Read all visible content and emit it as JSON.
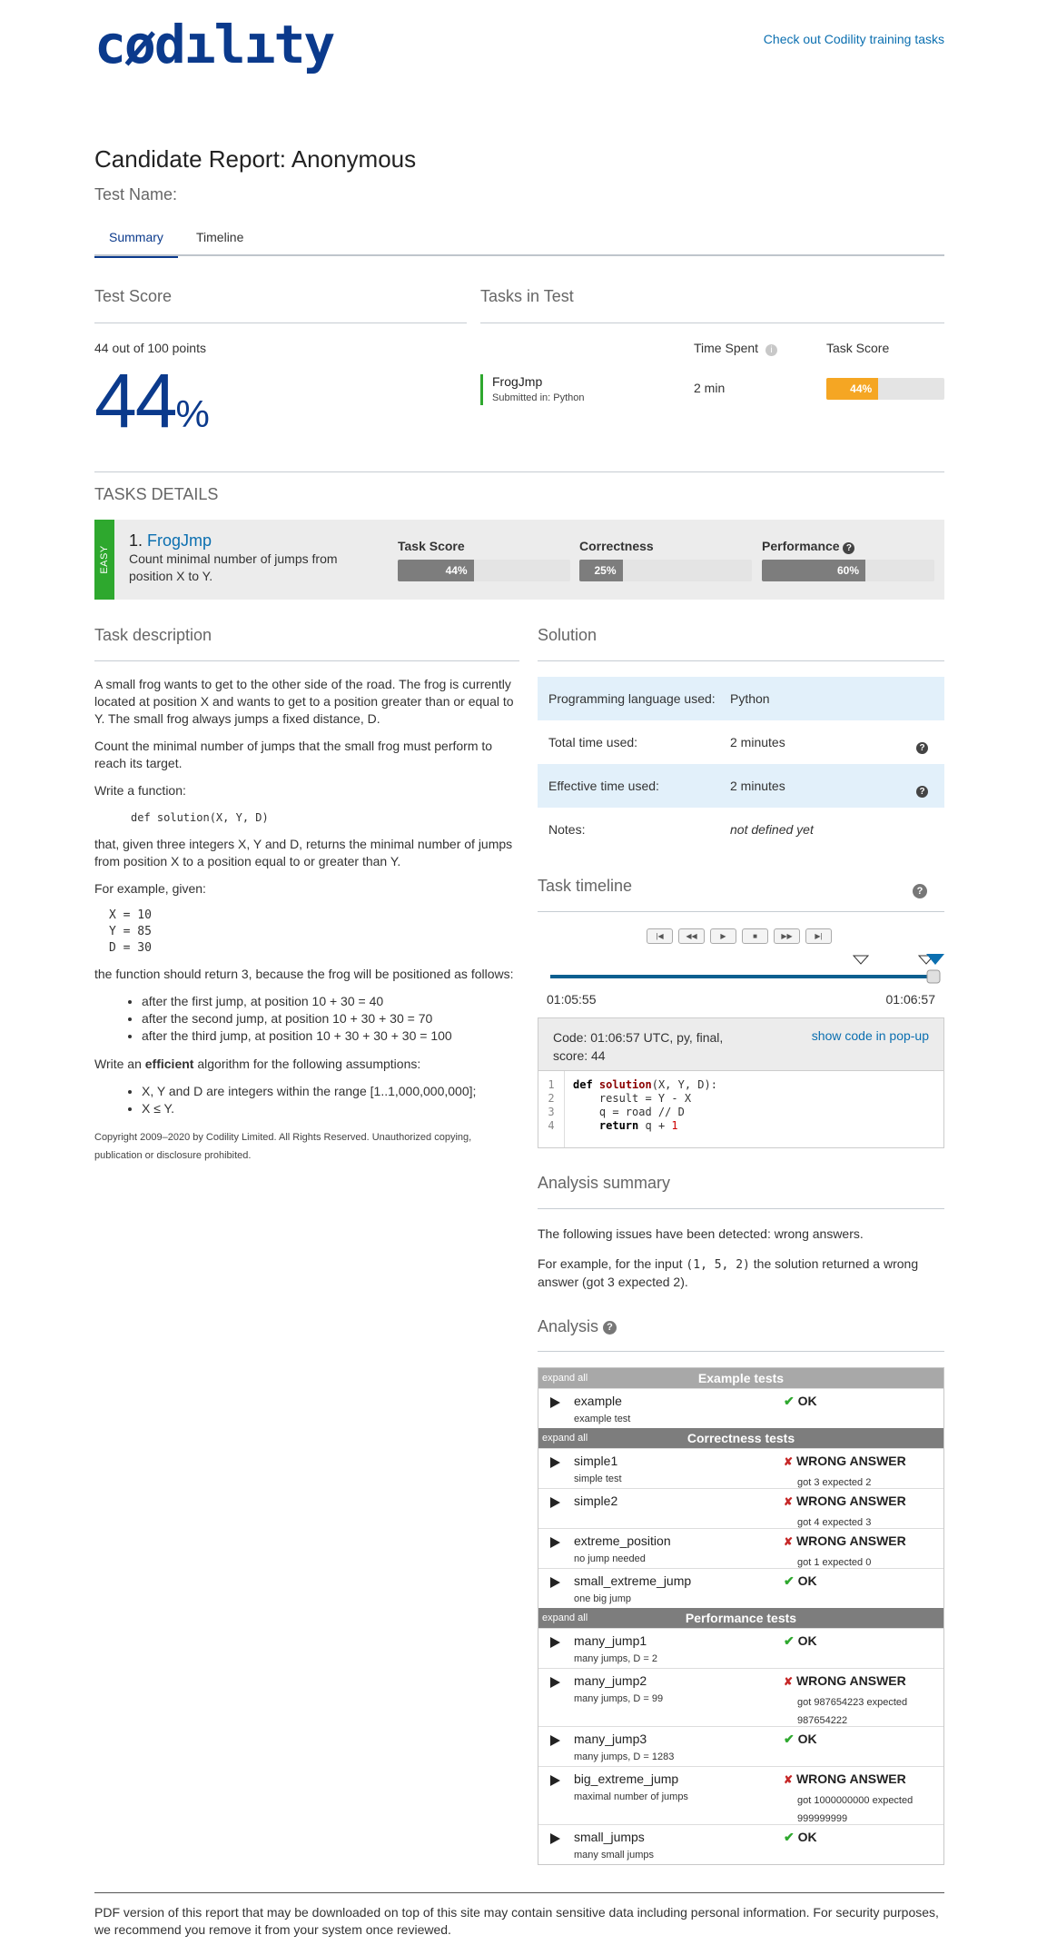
{
  "header": {
    "logo": "cødılıty",
    "training_link": "Check out Codility training tasks"
  },
  "report": {
    "title_prefix": "Candidate Report:",
    "candidate": "Anonymous",
    "test_name_label": "Test Name:"
  },
  "tabs": [
    {
      "label": "Summary",
      "active": true
    },
    {
      "label": "Timeline",
      "active": false
    }
  ],
  "test_score": {
    "heading": "Test Score",
    "points": "44 out of 100 points",
    "value": "44",
    "pct_sign": "%"
  },
  "tasks_in_test": {
    "heading": "Tasks in Test",
    "col_time": "Time Spent",
    "col_score": "Task Score",
    "task": {
      "name": "FrogJmp",
      "submitted": "Submitted in: Python",
      "time": "2 min",
      "score_label": "44%",
      "score": 44
    }
  },
  "tasks_details": {
    "heading": "TASKS DETAILS",
    "difficulty": "EASY",
    "number": "1.",
    "name": "FrogJmp",
    "summary": "Count minimal number of jumps from position X to Y.",
    "metrics": [
      {
        "label": "Task Score",
        "value_label": "44%",
        "value": 44
      },
      {
        "label": "Correctness",
        "value_label": "25%",
        "value": 25
      },
      {
        "label": "Performance",
        "value_label": "60%",
        "value": 60
      }
    ]
  },
  "task_description": {
    "heading": "Task description",
    "p1": "A small frog wants to get to the other side of the road. The frog is currently located at position X and wants to get to a position greater than or equal to Y. The small frog always jumps a fixed distance, D.",
    "p2": "Count the minimal number of jumps that the small frog must perform to reach its target.",
    "p3": "Write a function:",
    "signature": "def solution(X, Y, D)",
    "p4": "that, given three integers X, Y and D, returns the minimal number of jumps from position X to a position equal to or greater than Y.",
    "p5": "For example, given:",
    "example": [
      "X = 10",
      "Y = 85",
      "D = 30"
    ],
    "p6": "the function should return 3, because the frog will be positioned as follows:",
    "bullets": [
      "after the first jump, at position 10 + 30 = 40",
      "after the second jump, at position 10 + 30 + 30 = 70",
      "after the third jump, at position 10 + 30 + 30 + 30 = 100"
    ],
    "p7_pre": "Write an",
    "p7_bold": "efficient",
    "p7_post": "algorithm for the following assumptions:",
    "assumptions": [
      "X, Y and D are integers within the range [1..1,000,000,000];",
      "X ≤ Y."
    ],
    "copyright": "Copyright 2009–2020 by Codility Limited. All Rights Reserved. Unauthorized copying, publication or disclosure prohibited."
  },
  "solution": {
    "heading": "Solution",
    "rows": [
      {
        "label": "Programming language used:",
        "value": "Python"
      },
      {
        "label": "Total time used:",
        "value": "2 minutes"
      },
      {
        "label": "Effective time used:",
        "value": "2 minutes"
      },
      {
        "label": "Notes:",
        "value": "not defined yet"
      }
    ]
  },
  "timeline": {
    "heading": "Task timeline",
    "start": "01:05:55",
    "end": "01:06:57",
    "position": 1.0
  },
  "code_panel": {
    "info_line1": "Code: 01:06:57 UTC, py, final,",
    "info_line2": "score:",
    "score": "44",
    "popup_link": "show code in pop-up",
    "line_numbers": [
      "1",
      "2",
      "3",
      "4"
    ]
  },
  "analysis_summary": {
    "heading": "Analysis summary",
    "p1": "The following issues have been detected: wrong answers.",
    "p2_pre": "For example, for the input",
    "p2_code": "(1, 5, 2)",
    "p2_post": "the solution returned a wrong answer (got 3 expected 2)."
  },
  "analysis": {
    "heading": "Analysis",
    "expand_all": "expand all",
    "groups": [
      {
        "title": "Example tests",
        "color": "#a8a8a8",
        "tests": [
          {
            "name": "example",
            "sub": "example test",
            "ok": true,
            "result": "OK",
            "detail": ""
          }
        ]
      },
      {
        "title": "Correctness tests",
        "color": "#7d7d7d",
        "tests": [
          {
            "name": "simple1",
            "sub": "simple test",
            "ok": false,
            "result": "WRONG ANSWER",
            "detail": "got 3 expected 2"
          },
          {
            "name": "simple2",
            "sub": "",
            "ok": false,
            "result": "WRONG ANSWER",
            "detail": "got 4 expected 3"
          },
          {
            "name": "extreme_position",
            "sub": "no jump needed",
            "ok": false,
            "result": "WRONG ANSWER",
            "detail": "got 1 expected 0"
          },
          {
            "name": "small_extreme_jump",
            "sub": "one big jump",
            "ok": true,
            "result": "OK",
            "detail": ""
          }
        ]
      },
      {
        "title": "Performance tests",
        "color": "#7d7d7d",
        "tests": [
          {
            "name": "many_jump1",
            "sub": "many jumps, D = 2",
            "ok": true,
            "result": "OK",
            "detail": ""
          },
          {
            "name": "many_jump2",
            "sub": "many jumps, D = 99",
            "ok": false,
            "result": "WRONG ANSWER",
            "detail": "got 987654223 expected 987654222"
          },
          {
            "name": "many_jump3",
            "sub": "many jumps, D = 1283",
            "ok": true,
            "result": "OK",
            "detail": ""
          },
          {
            "name": "big_extreme_jump",
            "sub": "maximal number of jumps",
            "ok": false,
            "result": "WRONG ANSWER",
            "detail": "got 1000000000 expected 999999999"
          },
          {
            "name": "small_jumps",
            "sub": "many small jumps",
            "ok": true,
            "result": "OK",
            "detail": ""
          }
        ]
      }
    ]
  },
  "footer": {
    "notice": "PDF version of this report that may be downloaded on top of this site may contain sensitive data including personal information. For security purposes, we recommend you remove it from your system once reviewed."
  }
}
